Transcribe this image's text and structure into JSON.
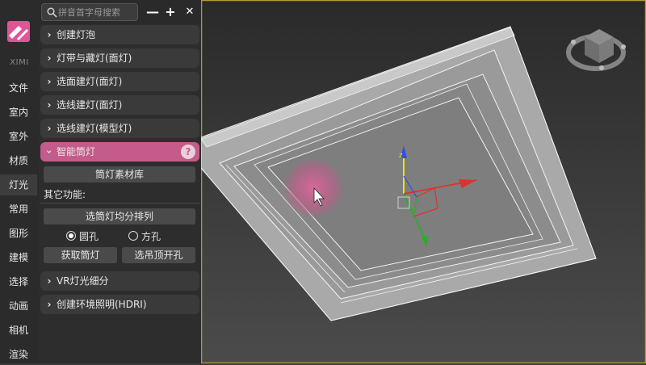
{
  "brand": {
    "name": "XIMI",
    "logo_icon": "ximi-logo-icon",
    "accent_color": "#c45b8b"
  },
  "categories": [
    {
      "label": "文件"
    },
    {
      "label": "室内"
    },
    {
      "label": "室外"
    },
    {
      "label": "材质"
    },
    {
      "label": "灯光",
      "active": true
    },
    {
      "label": "常用"
    },
    {
      "label": "图形"
    },
    {
      "label": "建模"
    },
    {
      "label": "选择"
    },
    {
      "label": "动画"
    },
    {
      "label": "相机"
    },
    {
      "label": "渲染"
    }
  ],
  "search": {
    "placeholder": "拼音首字母搜索",
    "value": ""
  },
  "toolbar": {
    "collapse_label": "—",
    "add_label": "+",
    "close_label": "✕"
  },
  "sections": [
    {
      "label": "创建灯泡"
    },
    {
      "label": "灯带与藏灯(面灯)"
    },
    {
      "label": "选面建灯(面灯)"
    },
    {
      "label": "选线建灯(面灯)"
    },
    {
      "label": "选线建灯(模型灯)"
    },
    {
      "label": "智能筒灯",
      "expanded": true,
      "help": "?"
    },
    {
      "label": "VR灯光细分"
    },
    {
      "label": "创建环境照明(HDRI)"
    }
  ],
  "downlight": {
    "library_button": "筒灯素材库",
    "other_functions_label": "其它功能:",
    "distribute_button": "选筒灯均分排列",
    "radio_round": {
      "label": "圆孔",
      "checked": true
    },
    "radio_square": {
      "label": "方孔",
      "checked": false
    },
    "get_button": "获取筒灯",
    "ceiling_hole_button": "选吊顶开孔"
  },
  "viewport": {
    "background_top": "#2b2b2b",
    "background_bottom": "#4a4a4a",
    "gizmo_colors": {
      "x": "#e03030",
      "y": "#2eaa2e",
      "z": "#3050e0",
      "selected": "#e8e800"
    }
  }
}
